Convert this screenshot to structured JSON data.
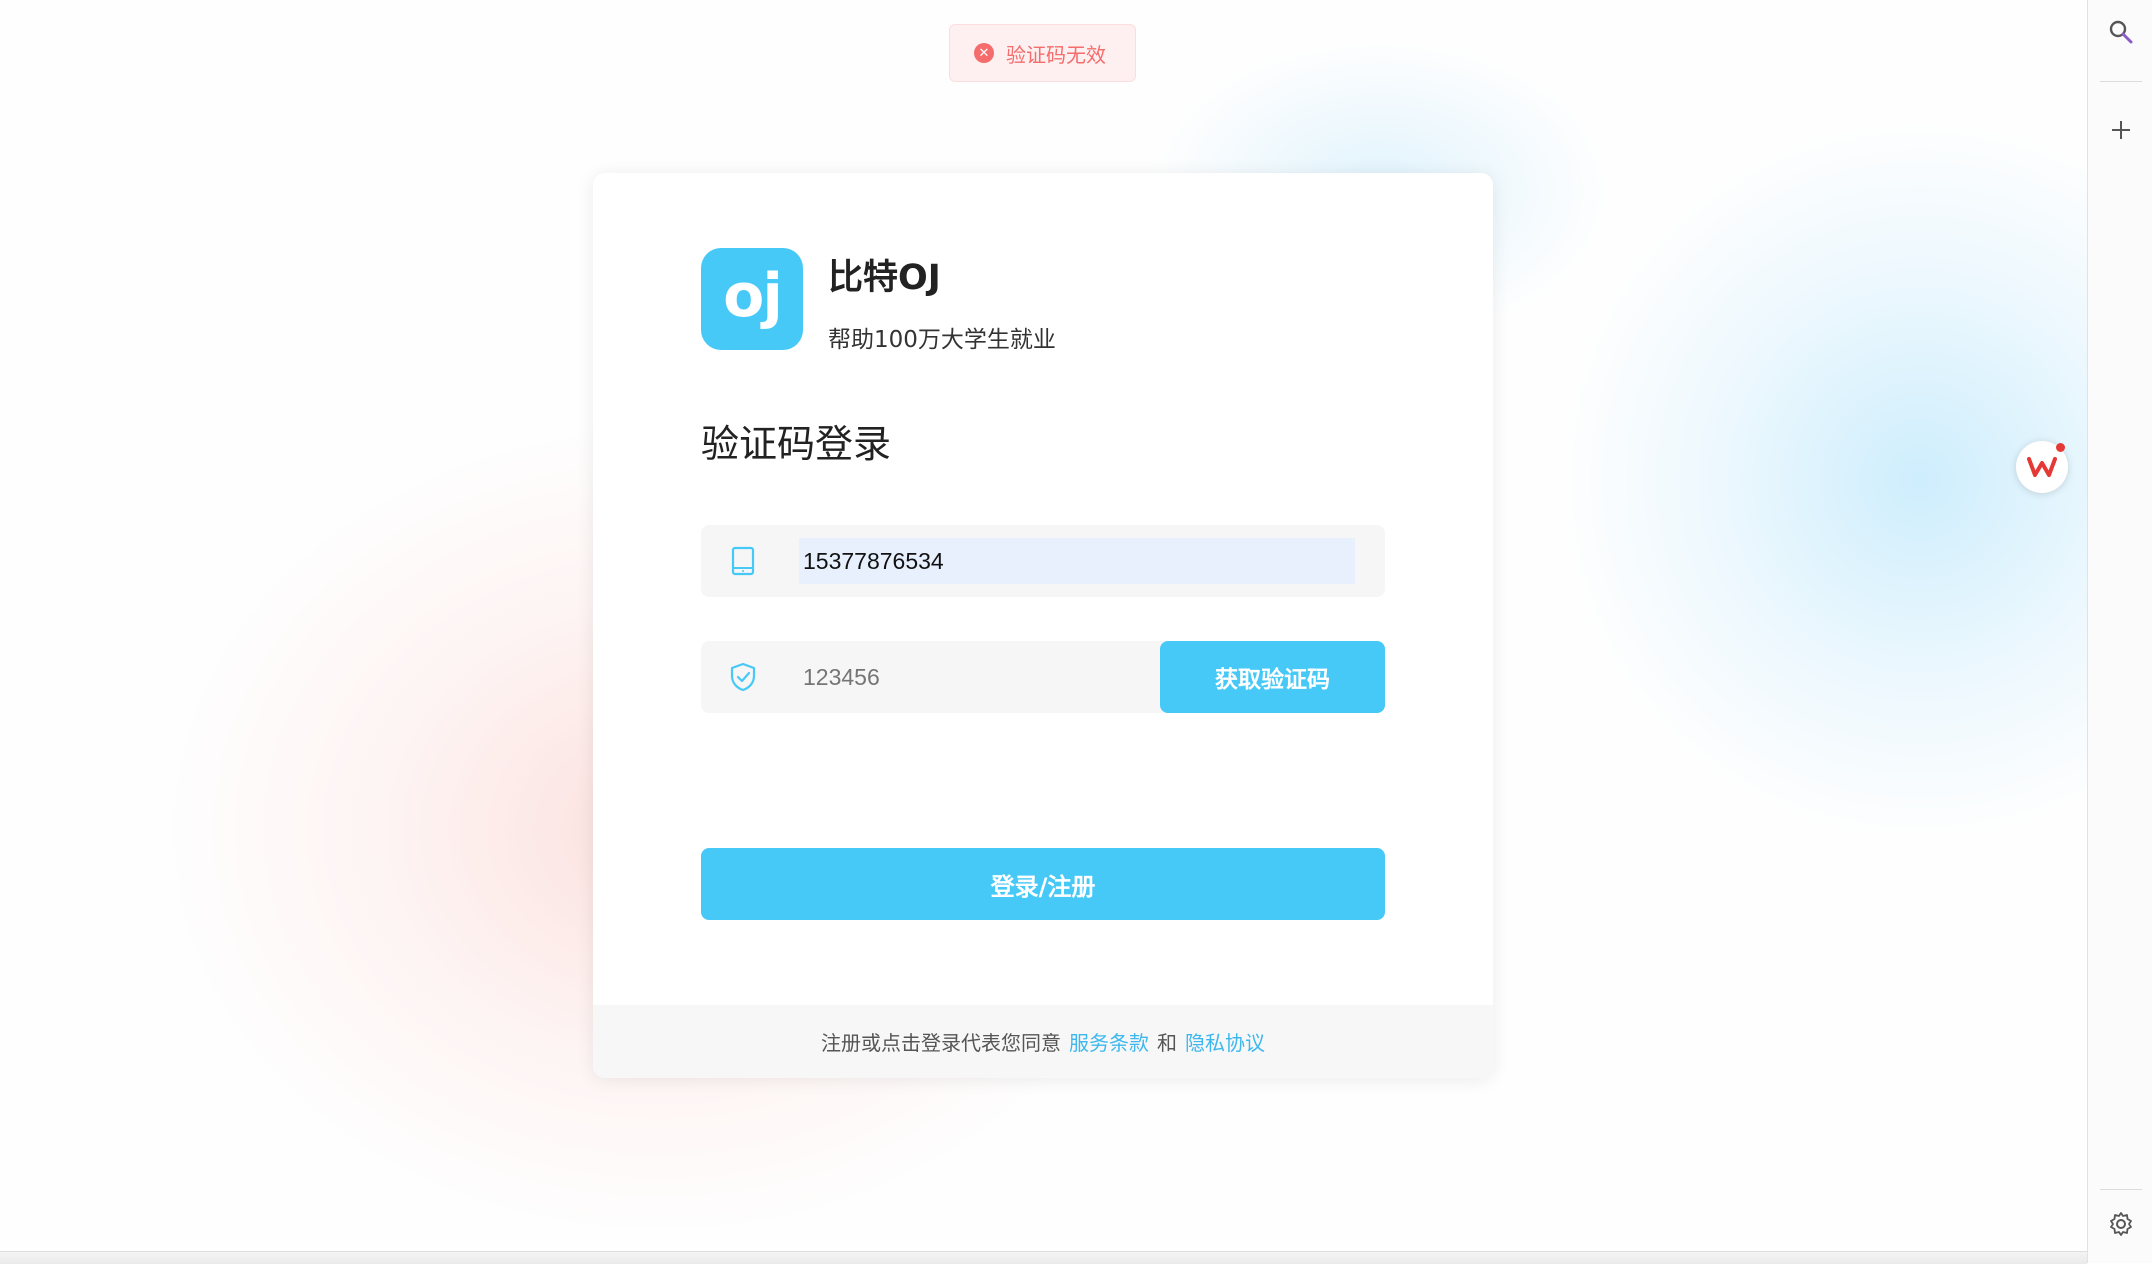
{
  "toast": {
    "icon": "close-circle-icon",
    "message": "验证码无效",
    "color": "#f56c6c"
  },
  "brand": {
    "logo_text": "oj",
    "name": "比特OJ",
    "slogan": "帮助100万大学生就业",
    "accent": "#47c9f8"
  },
  "form": {
    "title": "验证码登录",
    "phone": {
      "icon": "tablet-icon",
      "value": "15377876534"
    },
    "code": {
      "icon": "shield-check-icon",
      "placeholder": "123456",
      "value": ""
    },
    "get_code_label": "获取验证码",
    "submit_label": "登录/注册"
  },
  "footer": {
    "prefix": "注册或点击登录代表您同意",
    "terms": "服务条款",
    "and": "和",
    "privacy": "隐私协议"
  },
  "sidebar": {
    "icons": [
      "search-icon",
      "plus-icon",
      "settings-icon"
    ]
  },
  "floating": {
    "icon": "wps-icon",
    "label": "W"
  }
}
